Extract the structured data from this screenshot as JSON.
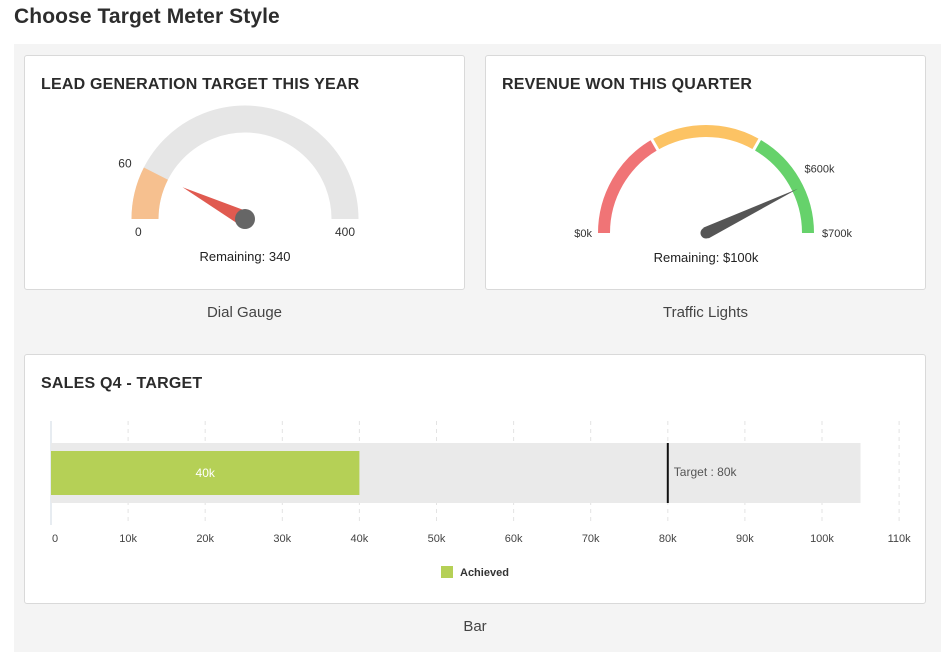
{
  "page": {
    "title": "Choose Target Meter Style"
  },
  "cards": {
    "dial": {
      "title": "LEAD GENERATION TARGET THIS YEAR",
      "min_label": "0",
      "max_label": "400",
      "value_label": "60",
      "remaining": "Remaining: 340",
      "caption": "Dial Gauge",
      "min": 0,
      "max": 400,
      "value": 60,
      "colors": {
        "fill": "#f6c08f",
        "track": "#e6e6e6",
        "needle": "#e05a50",
        "hub": "#666666"
      }
    },
    "traffic": {
      "title": "REVENUE WON THIS QUARTER",
      "min_label": "$0k",
      "max_label": "$700k",
      "value_label": "$600k",
      "remaining": "Remaining: $100k",
      "caption": "Traffic Lights",
      "min": 0,
      "max": 700,
      "value": 600,
      "bands": [
        {
          "from": 0,
          "to": 233,
          "color": "#f07476"
        },
        {
          "from": 233,
          "to": 466,
          "color": "#fcc364"
        },
        {
          "from": 466,
          "to": 700,
          "color": "#66d26b"
        }
      ],
      "colors": {
        "needle": "#555555"
      }
    },
    "bar": {
      "title": "SALES Q4 - TARGET",
      "caption": "Bar",
      "achieved_label": "40k",
      "target_label": "Target : 80k",
      "legend": "Achieved",
      "ticks": [
        "0",
        "10k",
        "20k",
        "30k",
        "40k",
        "50k",
        "60k",
        "70k",
        "80k",
        "90k",
        "100k",
        "110k"
      ],
      "colors": {
        "achieved": "#b5d056",
        "track": "#eaeaea",
        "target": "#111111"
      }
    }
  },
  "chart_data": [
    {
      "type": "gauge",
      "title": "LEAD GENERATION TARGET THIS YEAR",
      "min": 0,
      "max": 400,
      "value": 60
    },
    {
      "type": "gauge",
      "title": "REVENUE WON THIS QUARTER",
      "min": 0,
      "max": 700,
      "value": 600,
      "unit": "$k"
    },
    {
      "type": "bar",
      "title": "SALES Q4 - TARGET",
      "series": [
        {
          "name": "Achieved",
          "values": [
            40
          ]
        }
      ],
      "target": 80,
      "track_max": 105,
      "xlim": [
        0,
        110
      ],
      "unit": "k"
    }
  ]
}
